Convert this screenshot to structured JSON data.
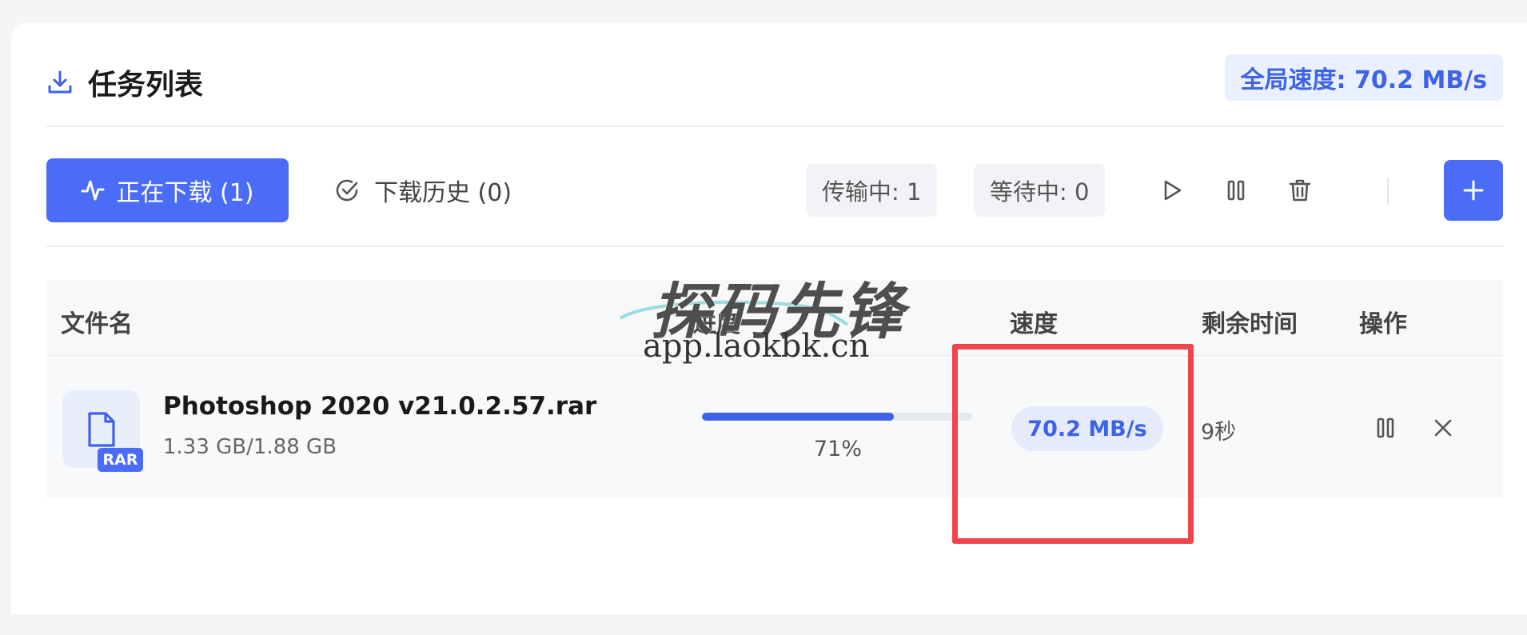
{
  "header": {
    "title": "任务列表",
    "global_speed": "全局速度: 70.2 MB/s"
  },
  "tabs": {
    "active_label": "正在下载 (1)",
    "history_label": "下载历史 (0)"
  },
  "stats": {
    "transferring": "传输中: 1",
    "waiting": "等待中: 0"
  },
  "table": {
    "columns": [
      "文件名",
      "进度",
      "速度",
      "剩余时间",
      "操作"
    ],
    "rows": [
      {
        "file_name": "Photoshop 2020 v21.0.2.57.rar",
        "file_type": "RAR",
        "size": "1.33 GB/1.88 GB",
        "progress_percent": 71,
        "progress_label": "71%",
        "speed": "70.2 MB/s",
        "remaining": "9秒"
      }
    ]
  },
  "watermark": {
    "title": "探码先锋",
    "url": "app.laokbk.cn"
  },
  "icons": {
    "header": "download-icon",
    "active_tab": "activity-icon",
    "history_tab": "check-circle-icon",
    "start": "play-icon",
    "pause": "pause-icon",
    "delete": "trash-icon",
    "add": "plus-icon",
    "row_pause": "pause-icon",
    "row_cancel": "close-icon",
    "file": "file-icon"
  },
  "colors": {
    "accent": "#4a6cf7",
    "accent_dark": "#3d63e6",
    "highlight_box": "#f0454d"
  }
}
